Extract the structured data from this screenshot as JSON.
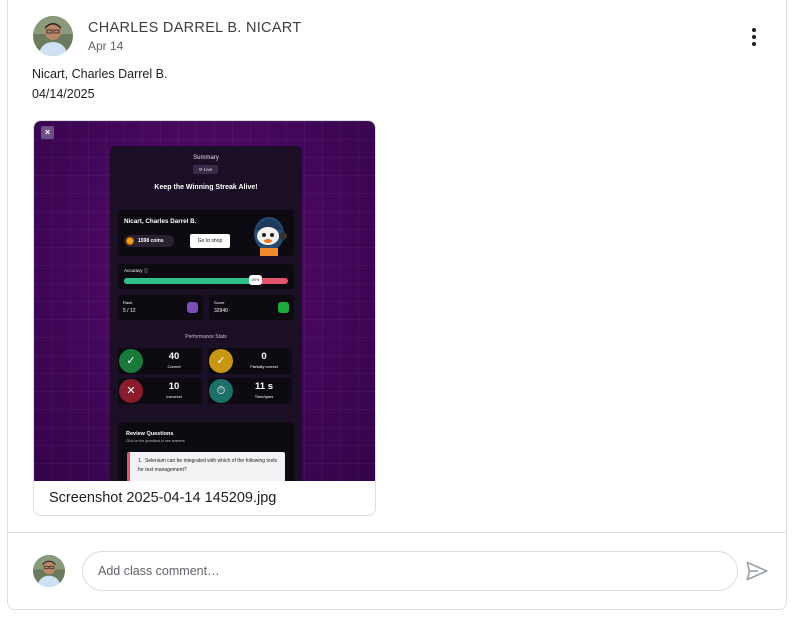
{
  "post": {
    "author": "CHARLES DARREL B. NICART",
    "date": "Apr 14",
    "body_line1": "Nicart, Charles Darrel B.",
    "body_line2": "04/14/2025"
  },
  "attachment": {
    "filename": "Screenshot 2025-04-14 145209.jpg",
    "close_glyph": "×",
    "preview": {
      "summary": "Summary",
      "live": "Live",
      "headline": "Keep the Winning Streak Alive!",
      "name": "Nicart, Charles Darrel B.",
      "coins": "1598 coins",
      "shop_button": "Go to shop",
      "accuracy_label": "Accuracy",
      "accuracy_value": "80%",
      "accuracy_fraction": 0.8,
      "rank_label": "Rank",
      "rank_value": "5 / 12",
      "score_label": "Score",
      "score_value": "32940",
      "perf_title": "Performance Stats",
      "stats": [
        {
          "value": "40",
          "label": "Correct",
          "color": "#1a7a3c",
          "icon": "check-icon"
        },
        {
          "value": "0",
          "label": "Partially correct",
          "color": "#c99612",
          "icon": "check-icon"
        },
        {
          "value": "10",
          "label": "Incorrect",
          "color": "#8a1b2c",
          "icon": "cross-icon"
        },
        {
          "value": "11 s",
          "label": "Time/ques",
          "color": "#1d6f6a",
          "icon": "timer-icon"
        }
      ],
      "review_title": "Review Questions",
      "review_sub": "Click on the questions to see answers",
      "question": "Selenium can be integrated with which of the following tools for test management?",
      "question_number": "1"
    }
  },
  "comment": {
    "placeholder": "Add class comment…"
  },
  "colors": {
    "border": "#dadce0",
    "text_primary": "#202124",
    "text_secondary": "#5f6368",
    "preview_bg": "#43075a"
  }
}
